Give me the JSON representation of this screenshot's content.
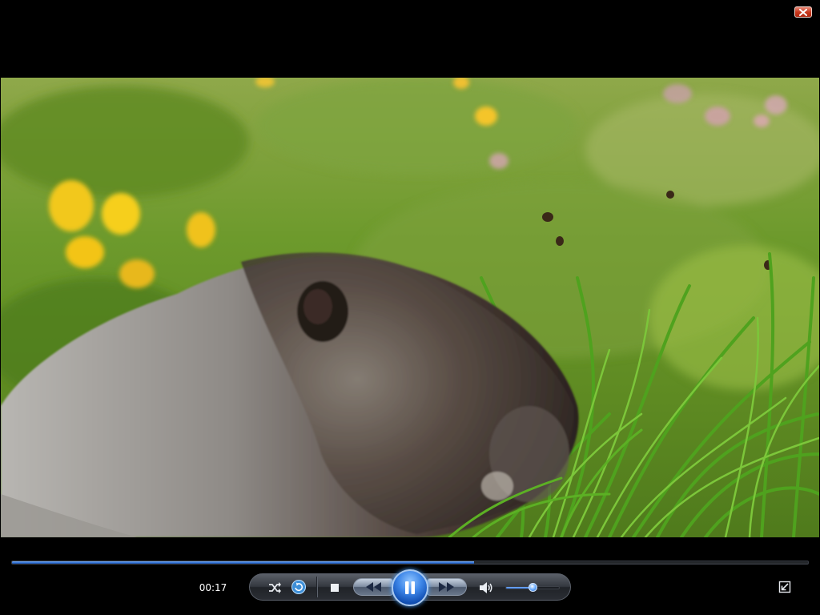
{
  "window": {
    "close_label": "Close"
  },
  "video": {
    "scene": "marmot-in-meadow"
  },
  "playback": {
    "elapsed": "00:17",
    "progress_fraction": 0.58,
    "volume_fraction": 0.5,
    "state": "playing"
  },
  "controls": {
    "shuffle_icon": "shuffle-icon",
    "repeat_icon": "repeat-icon",
    "stop_icon": "stop-icon",
    "previous_icon": "rewind-icon",
    "play_pause_icon": "pause-icon",
    "next_icon": "fast-forward-icon",
    "volume_icon": "speaker-icon",
    "restore_icon": "exit-fullscreen-icon"
  },
  "colors": {
    "accent": "#2f6fd4",
    "close_red": "#c8391e",
    "background": "#000000"
  }
}
